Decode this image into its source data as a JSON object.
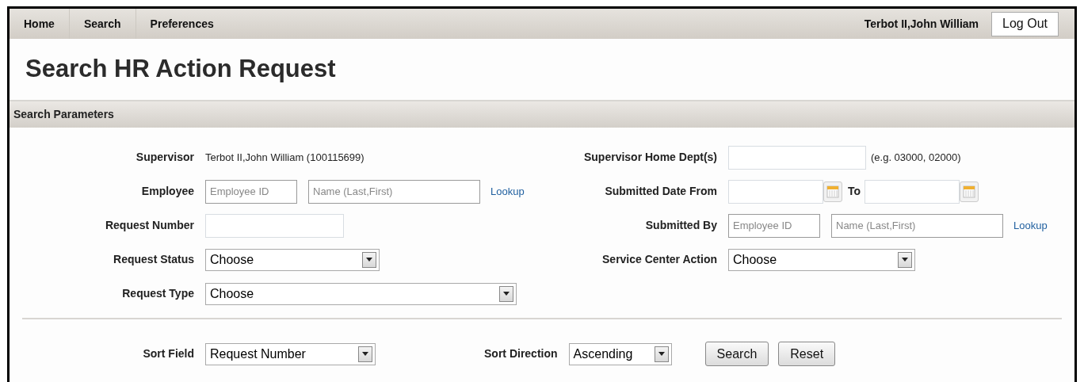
{
  "nav": {
    "items": [
      {
        "label": "Home"
      },
      {
        "label": "Search"
      },
      {
        "label": "Preferences"
      }
    ],
    "user": "Terbot II,John William",
    "logout": "Log Out"
  },
  "title": "Search HR Action Request",
  "section": "Search Parameters",
  "left_fields": [
    {
      "kind": "text",
      "label": "Supervisor",
      "value": "Terbot II,John William (100115699)"
    },
    {
      "kind": "person",
      "label": "Employee",
      "id_placeholder": "Employee ID",
      "name_placeholder": "Name (Last,First)",
      "link": "Lookup"
    },
    {
      "kind": "input",
      "label": "Request Number"
    },
    {
      "kind": "select",
      "label": "Request Status",
      "value": "Choose"
    },
    {
      "kind": "select",
      "label": "Request Type",
      "value": "Choose"
    }
  ],
  "right_fields": [
    {
      "kind": "input",
      "label": "Supervisor Home Dept(s)",
      "hint": "(e.g. 03000, 02000)"
    },
    {
      "kind": "date_range",
      "label": "Submitted Date From",
      "separator": "To"
    },
    {
      "kind": "person",
      "label": "Submitted By",
      "id_placeholder": "Employee ID",
      "name_placeholder": "Name (Last,First)",
      "link": "Lookup"
    },
    {
      "kind": "select",
      "label": "Service Center Action",
      "value": "Choose"
    }
  ],
  "sort": {
    "field_label": "Sort Field",
    "field_value": "Request Number",
    "direction_label": "Sort Direction",
    "direction_value": "Ascending",
    "buttons": [
      "Search",
      "Reset"
    ]
  }
}
